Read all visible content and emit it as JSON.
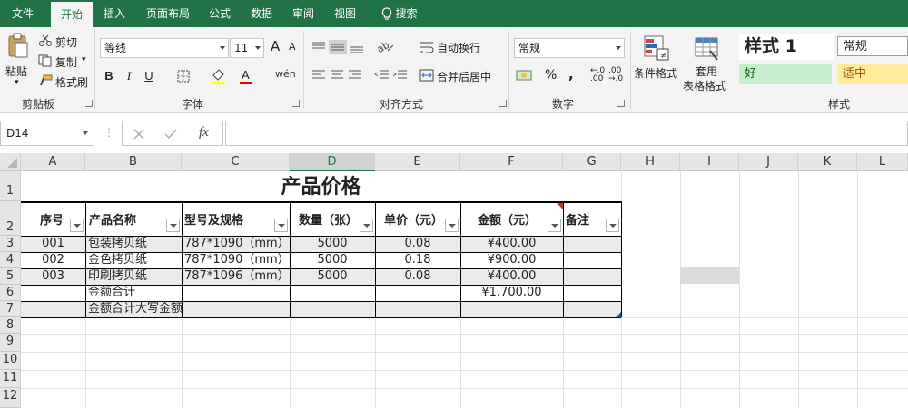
{
  "tabs": [
    "文件",
    "开始",
    "插入",
    "页面布局",
    "公式",
    "数据",
    "审阅",
    "视图",
    "搜索"
  ],
  "ribbon": {
    "clipboard": {
      "paste": "粘贴",
      "cut": "剪切",
      "copy": "复制",
      "format_painter": "格式刷",
      "label": "剪贴板"
    },
    "font": {
      "name": "等线",
      "size": "11",
      "label": "字体",
      "grow": "A",
      "shrink": "A"
    },
    "alignment": {
      "wrap": "自动换行",
      "merge": "合并后居中",
      "label": "对齐方式"
    },
    "number": {
      "format": "常规",
      "label": "数字",
      "percent": "%",
      "comma": ","
    },
    "styles": {
      "cond_format": "条件格式",
      "table_format_1": "套用",
      "table_format_2": "表格格式",
      "style1": "样式 1",
      "normal": "常规",
      "good": "好",
      "neutral": "适中",
      "label": "样式"
    }
  },
  "formula_bar": {
    "name_box": "D14",
    "fx": "fx",
    "value": ""
  },
  "columns": [
    "A",
    "B",
    "C",
    "D",
    "E",
    "F",
    "G",
    "H",
    "I",
    "J",
    "K",
    "L"
  ],
  "rows": [
    "1",
    "2",
    "3",
    "4",
    "5",
    "6",
    "7",
    "8",
    "9",
    "10",
    "11",
    "12"
  ],
  "sheet": {
    "title": "产品价格",
    "headers": [
      "序号",
      "产品名称",
      "型号及规格",
      "数量（张）",
      "单价（元）",
      "金额（元）",
      "备注"
    ],
    "data": [
      [
        "001",
        "包装拷贝纸",
        "787*1090（mm）",
        "5000",
        "0.08",
        "¥400.00",
        ""
      ],
      [
        "002",
        "金色拷贝纸",
        "787*1090（mm）",
        "5000",
        "0.18",
        "¥900.00",
        ""
      ],
      [
        "003",
        "印刷拷贝纸",
        "787*1096（mm）",
        "5000",
        "0.08",
        "¥400.00",
        ""
      ]
    ],
    "total_label": "金额合计",
    "total_value": "¥1,700.00",
    "total_upper_label": "金额合计大写金额"
  },
  "colors": {
    "accent": "#217346",
    "good_bg": "#c6efce",
    "good_fg": "#006100",
    "neutral_bg": "#ffeb9c",
    "neutral_fg": "#9c5700"
  }
}
